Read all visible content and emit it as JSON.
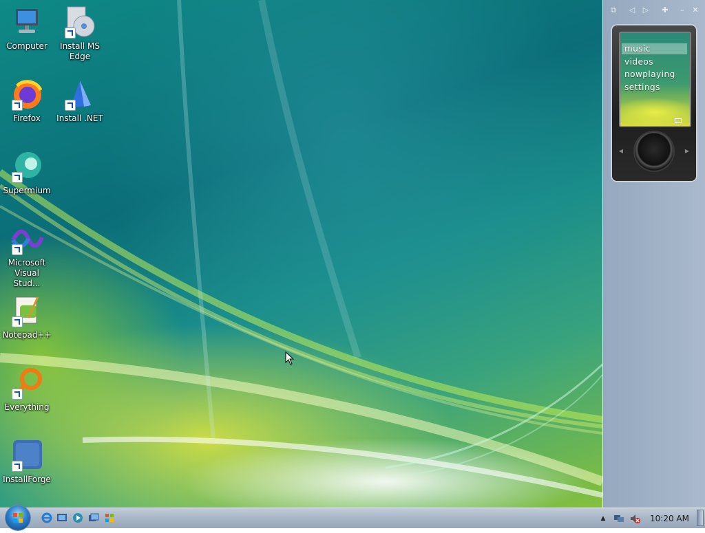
{
  "desktop": {
    "icons": [
      {
        "label": "Computer",
        "icon": "computer-icon"
      },
      {
        "label": "Install MS Edge",
        "icon": "install-ms-edge-icon"
      },
      {
        "label": "Firefox",
        "icon": "firefox-icon"
      },
      {
        "label": "Install .NET",
        "icon": "install-dotnet-icon"
      },
      {
        "label": "Supermium",
        "icon": "supermium-icon"
      },
      {
        "label": "Microsoft Visual Stud...",
        "icon": "visual-studio-icon"
      },
      {
        "label": "Notepad++",
        "icon": "notepad-plus-plus-icon"
      },
      {
        "label": "Everything",
        "icon": "everything-icon"
      },
      {
        "label": "InstallForge",
        "icon": "installforge-icon"
      }
    ]
  },
  "sidebar": {
    "toolbar": [
      "gadgets-icon",
      "previous-icon",
      "next-icon",
      "add-gadget-icon",
      "minimize-icon",
      "close-icon"
    ],
    "zune_gadget": {
      "menu": [
        "music",
        "videos",
        "nowplaying",
        "settings"
      ],
      "selected": "music"
    }
  },
  "taskbar": {
    "quick_launch": [
      "internet-explorer-icon",
      "show-desktop-icon",
      "media-player-icon",
      "switch-windows-icon",
      "windows-explorer-icon"
    ],
    "tray_icons": [
      "show-hidden-icons-icon",
      "network-icon",
      "volume-muted-icon"
    ],
    "clock": "10:20 AM"
  },
  "colors": {
    "taskbar": "#a9b7c7",
    "sidebar": "#9fb0c5",
    "desktop_teal": "#0b6d78",
    "desktop_yellow": "#e6e63c"
  }
}
